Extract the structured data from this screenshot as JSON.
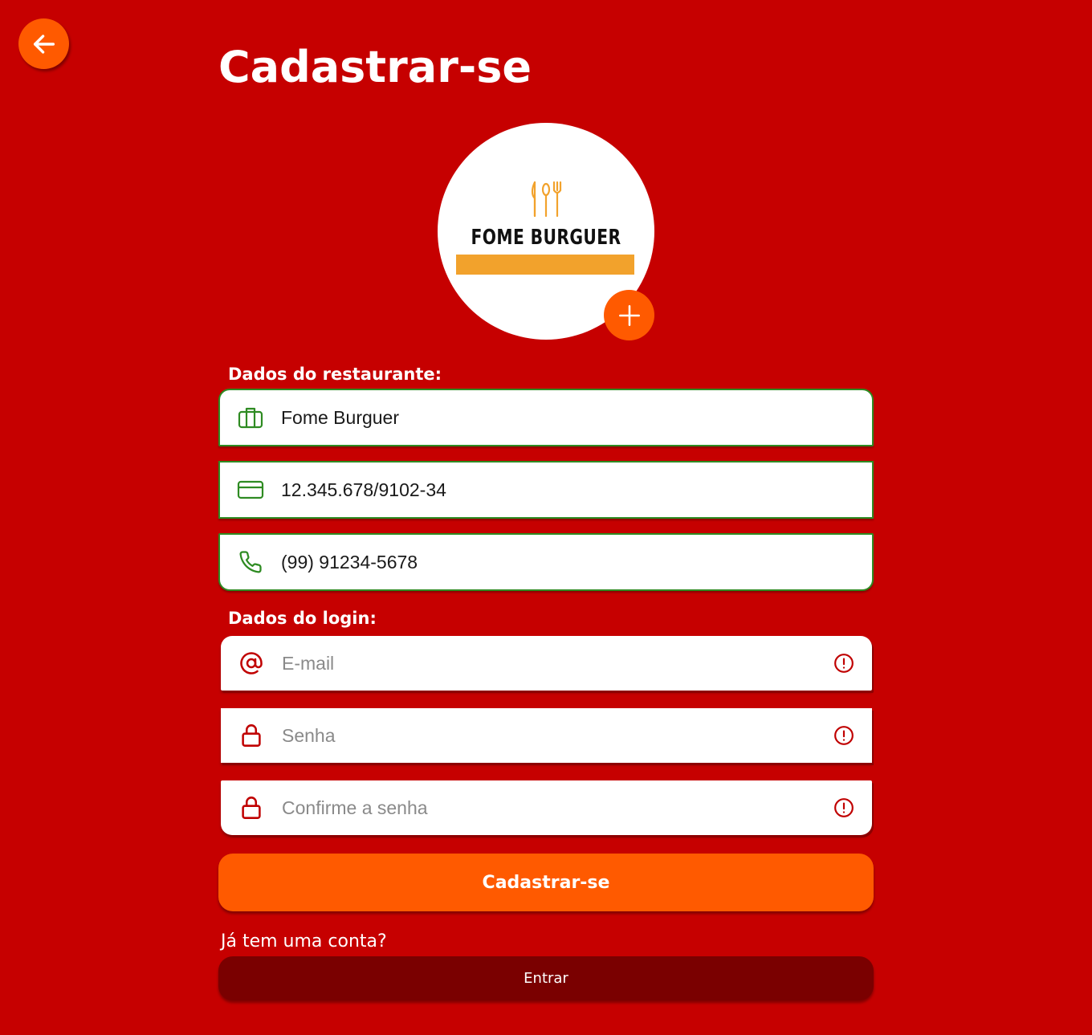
{
  "header": {
    "title": "Cadastrar-se"
  },
  "avatar": {
    "brand_name": "FOME BURGUER"
  },
  "restaurant_section": {
    "label": "Dados do restaurante:",
    "fields": [
      {
        "icon": "briefcase-icon",
        "value": "Fome Burguer"
      },
      {
        "icon": "credit-card-icon",
        "value": "12.345.678/9102-34"
      },
      {
        "icon": "phone-icon",
        "value": "(99) 91234-5678"
      }
    ]
  },
  "login_section": {
    "label": "Dados do login:",
    "fields": [
      {
        "icon": "at-sign-icon",
        "placeholder": "E-mail"
      },
      {
        "icon": "lock-icon",
        "placeholder": "Senha"
      },
      {
        "icon": "lock-icon",
        "placeholder": "Confirme a senha"
      }
    ]
  },
  "actions": {
    "submit_label": "Cadastrar-se",
    "question": "Já tem uma conta?",
    "login_label": "Entrar"
  },
  "colors": {
    "background": "#c60000",
    "accent": "#ff5a00",
    "valid": "#2e8b22",
    "error": "#c00000",
    "secondary_button": "#7a0000",
    "brand_bar": "#f2a22c"
  }
}
